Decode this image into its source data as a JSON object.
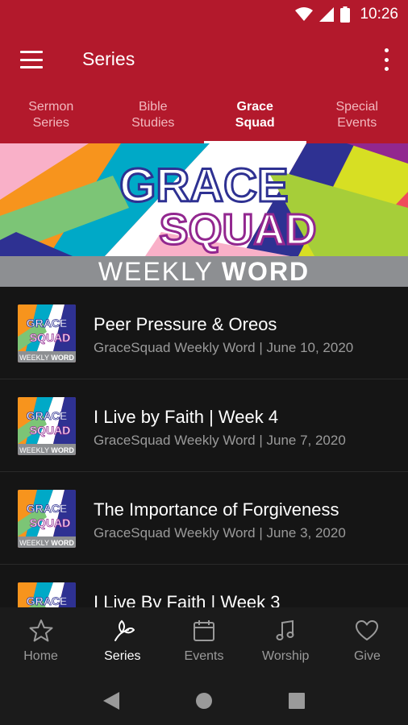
{
  "status_bar": {
    "time": "10:26"
  },
  "app_bar": {
    "title": "Series"
  },
  "tabs": [
    {
      "line1": "Sermon",
      "line2": "Series",
      "active": false
    },
    {
      "line1": "Bible",
      "line2": "Studies",
      "active": false
    },
    {
      "line1": "Grace",
      "line2": "Squad",
      "active": true
    },
    {
      "line1": "Special",
      "line2": "Events",
      "active": false
    }
  ],
  "banner": {
    "logo_line1": "GRACE",
    "logo_line2": "SQUAD",
    "strip_light": "WEEKLY",
    "strip_bold": "WORD"
  },
  "thumb": {
    "logo_line1": "GRACE",
    "logo_line2": "SQUAD",
    "strip_light": "WEEKLY",
    "strip_bold": "WORD"
  },
  "items": [
    {
      "title": "Peer Pressure & Oreos",
      "subtitle": "GraceSquad Weekly Word | June 10, 2020"
    },
    {
      "title": "I Live by Faith | Week 4",
      "subtitle": "GraceSquad Weekly Word | June 7, 2020"
    },
    {
      "title": "The Importance of Forgiveness",
      "subtitle": "GraceSquad Weekly Word | June 3, 2020"
    },
    {
      "title": "I Live By Faith | Week 3",
      "subtitle": ""
    }
  ],
  "bottom_nav": [
    {
      "label": "Home",
      "icon": "star-icon",
      "active": false
    },
    {
      "label": "Series",
      "icon": "sprout-icon",
      "active": true
    },
    {
      "label": "Events",
      "icon": "calendar-icon",
      "active": false
    },
    {
      "label": "Worship",
      "icon": "music-note-icon",
      "active": false
    },
    {
      "label": "Give",
      "icon": "heart-icon",
      "active": false
    }
  ],
  "colors": {
    "primary": "#b3192c",
    "background": "#151515",
    "nav_background": "#1b1b1b",
    "inactive": "#9a9a9a"
  }
}
